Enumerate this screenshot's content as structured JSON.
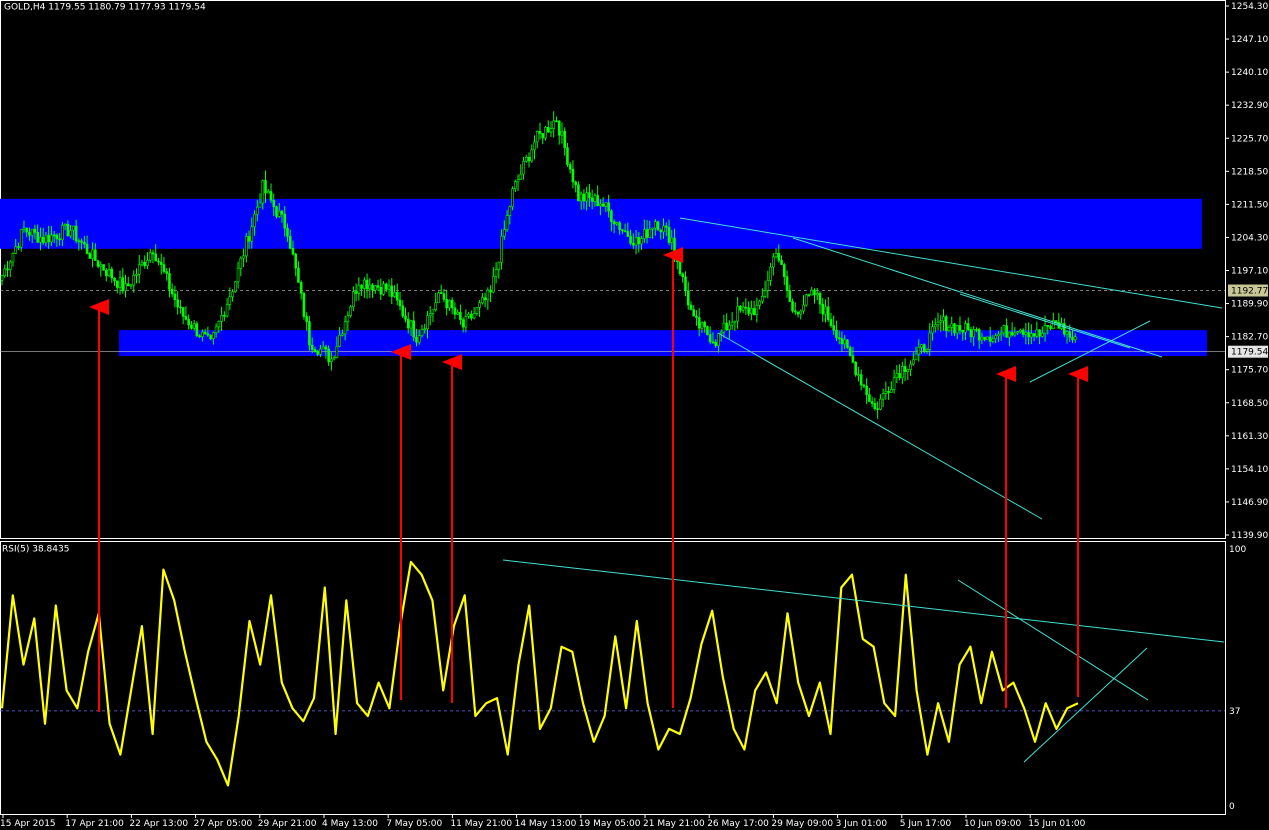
{
  "header": {
    "symbol_line": "GOLD,H4  1179.55 1180.79 1177.93 1179.54",
    "indicator_line": "RSI(5) 38.8435"
  },
  "colors": {
    "background": "#000000",
    "candle_body": "#00ff00",
    "rsi_line": "#ffff00",
    "zone_fill": "#0000ff",
    "trendline": "#40e0d0",
    "arrow": "#ff0000",
    "axis_text": "#ffffff",
    "price_tag": "#c0c0c0"
  },
  "chart_data": [
    {
      "type": "candlestick",
      "title": "",
      "ylim": [
        1139.9,
        1254.3
      ],
      "y_ticks": [
        "1254.30",
        "1247.10",
        "1240.10",
        "1232.90",
        "1225.70",
        "1218.50",
        "1211.50",
        "1204.30",
        "1197.10",
        "1189.90",
        "1182.70",
        "1175.70",
        "1168.50",
        "1161.30",
        "1154.10",
        "1146.90",
        "1139.90"
      ],
      "x_ticks": [
        "15 Apr 2015",
        "17 Apr 21:00",
        "22 Apr 13:00",
        "27 Apr 05:00",
        "29 Apr 21:00",
        "4 May 13:00",
        "7 May 05:00",
        "11 May 21:00",
        "14 May 13:00",
        "19 May 05:00",
        "21 May 21:00",
        "26 May 17:00",
        "29 May 09:00",
        "3 Jun 01:00",
        "5 Jun 17:00",
        "10 Jun 09:00",
        "15 Jun 01:00"
      ],
      "price_levels": [
        {
          "label": "1192.77",
          "value": 1192.77,
          "style": "dashed"
        },
        {
          "label": "1179.54",
          "value": 1179.54,
          "style": "solid"
        }
      ],
      "zones": [
        {
          "from": 1201.8,
          "to": 1212.6
        },
        {
          "from": 1178.6,
          "to": 1184.2
        }
      ],
      "close_anchors": [
        [
          0,
          1196
        ],
        [
          8,
          1206
        ],
        [
          15,
          1204
        ],
        [
          25,
          1206
        ],
        [
          33,
          1200
        ],
        [
          45,
          1193
        ],
        [
          55,
          1202
        ],
        [
          65,
          1188
        ],
        [
          76,
          1181
        ],
        [
          85,
          1195
        ],
        [
          95,
          1215
        ],
        [
          104,
          1206
        ],
        [
          112,
          1182
        ],
        [
          120,
          1178
        ],
        [
          130,
          1195
        ],
        [
          141,
          1193
        ],
        [
          151,
          1183
        ],
        [
          160,
          1192
        ],
        [
          168,
          1185
        ],
        [
          178,
          1192
        ],
        [
          186,
          1214
        ],
        [
          194,
          1225
        ],
        [
          202,
          1230
        ],
        [
          210,
          1213
        ],
        [
          218,
          1212
        ],
        [
          226,
          1206
        ],
        [
          232,
          1203
        ],
        [
          238,
          1208
        ],
        [
          244,
          1204
        ],
        [
          252,
          1186
        ],
        [
          260,
          1182
        ],
        [
          268,
          1188
        ],
        [
          276,
          1189
        ],
        [
          282,
          1202
        ],
        [
          288,
          1188
        ],
        [
          296,
          1192
        ],
        [
          304,
          1184
        ],
        [
          311,
          1176
        ],
        [
          318,
          1167
        ],
        [
          326,
          1175
        ],
        [
          334,
          1179
        ],
        [
          342,
          1186
        ],
        [
          352,
          1184
        ],
        [
          362,
          1183
        ],
        [
          370,
          1185
        ],
        [
          378,
          1183
        ],
        [
          384,
          1186
        ],
        [
          392,
          1181
        ]
      ]
    },
    {
      "type": "line",
      "title": "",
      "ylim": [
        0,
        100
      ],
      "y_ticks": [
        "100",
        "37",
        "0"
      ],
      "level": 37,
      "series": [
        {
          "values": [
            38,
            82,
            55,
            73,
            32,
            78,
            45,
            38,
            60,
            75,
            32,
            20,
            45,
            70,
            28,
            92,
            80,
            60,
            42,
            25,
            18,
            8,
            35,
            72,
            55,
            82,
            48,
            38,
            33,
            42,
            85,
            28,
            80,
            40,
            35,
            48,
            38,
            70,
            95,
            90,
            80,
            45,
            70,
            82,
            35,
            40,
            42,
            20,
            55,
            78,
            30,
            38,
            62,
            60,
            40,
            25,
            35,
            66,
            38,
            72,
            40,
            22,
            30,
            28,
            42,
            63,
            76,
            50,
            30,
            22,
            45,
            52,
            40,
            75,
            48,
            35,
            48,
            28,
            85,
            90,
            65,
            62,
            40,
            35,
            90,
            45,
            20,
            40,
            25,
            55,
            62,
            40,
            60,
            45,
            48,
            38,
            25,
            40,
            30,
            38,
            40
          ]
        }
      ]
    }
  ]
}
